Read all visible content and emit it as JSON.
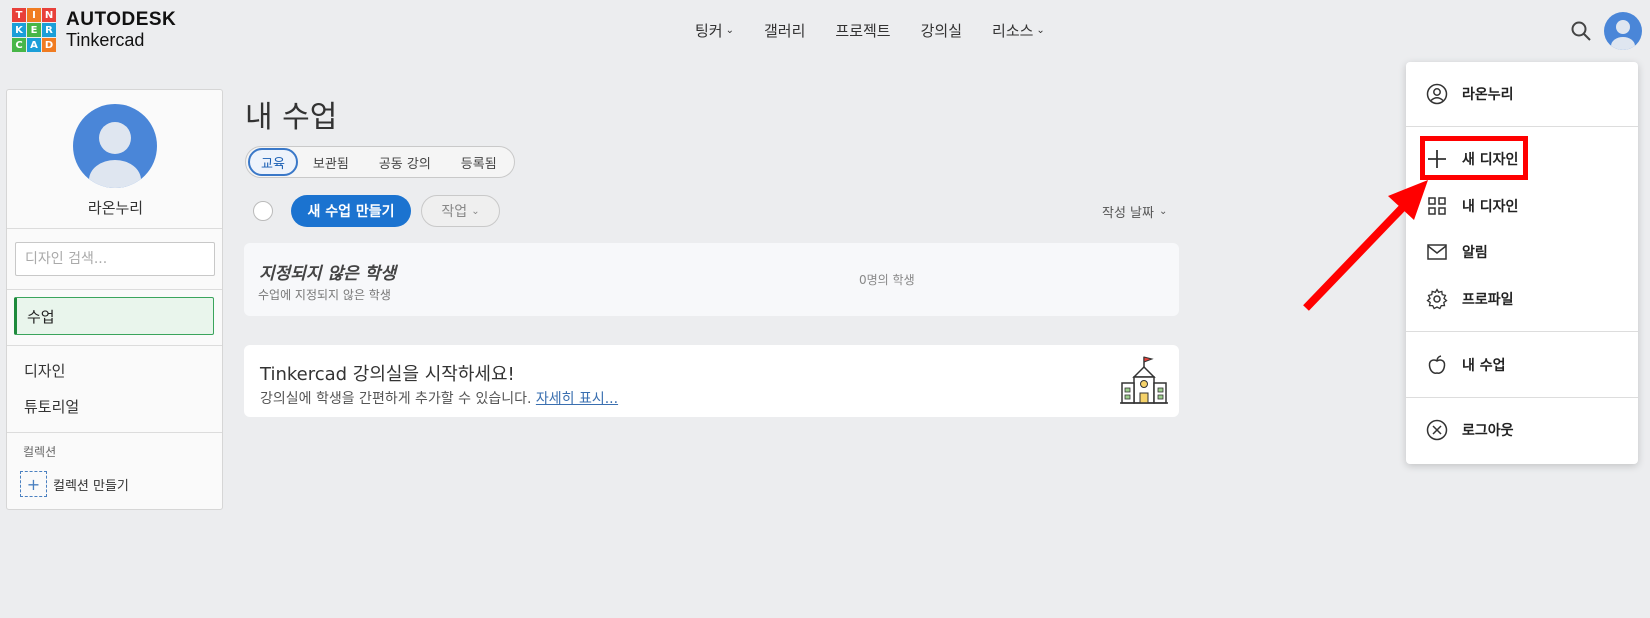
{
  "header": {
    "logo_letters": [
      "T",
      "I",
      "N",
      "K",
      "E",
      "R",
      "C",
      "A",
      "D"
    ],
    "logo_colors": [
      "#e8403a",
      "#f07c22",
      "#e8403a",
      "#1b9fd8",
      "#47b648",
      "#1b9fd8",
      "#47b648",
      "#1b9fd8",
      "#f07c22"
    ],
    "brand_line1": "AUTODESK",
    "brand_line2": "Tinkercad",
    "nav": [
      {
        "label": "팅커",
        "has_dropdown": true
      },
      {
        "label": "갤러리",
        "has_dropdown": false
      },
      {
        "label": "프로젝트",
        "has_dropdown": false
      },
      {
        "label": "강의실",
        "has_dropdown": false
      },
      {
        "label": "리소스",
        "has_dropdown": true
      }
    ],
    "icons": [
      "search-icon",
      "user-avatar"
    ]
  },
  "sidebar": {
    "user_name": "라온누리",
    "search_placeholder": "디자인 검색...",
    "active_item": "수업",
    "items": [
      "디자인",
      "튜토리얼"
    ],
    "section_label": "컬렉션",
    "create_collection": "컬렉션 만들기"
  },
  "main": {
    "title": "내 수업",
    "tabs": [
      "교육",
      "보관됨",
      "공동 강의",
      "등록됨"
    ],
    "active_tab": "교육",
    "new_class_button": "새 수업 만들기",
    "action_button": "작업",
    "sort_label": "작성 날짜",
    "unassigned": {
      "title": "지정되지 않은 학생",
      "subtitle": "수업에 지정되지 않은 학생",
      "count": "0명의 학생"
    },
    "promo": {
      "title": "Tinkercad 강의실을 시작하세요!",
      "text": "강의실에 학생을 간편하게 추가할 수 있습니다.",
      "link": "자세히 표시..."
    }
  },
  "dropdown": {
    "items": [
      {
        "label": "라온누리",
        "icon": "user-circle-icon"
      },
      {
        "label": "새 디자인",
        "icon": "plus-icon"
      },
      {
        "label": "내 디자인",
        "icon": "grid-icon"
      },
      {
        "label": "알림",
        "icon": "mail-icon"
      },
      {
        "label": "프로파일",
        "icon": "gear-icon"
      },
      {
        "label": "내 수업",
        "icon": "apple-icon"
      },
      {
        "label": "로그아웃",
        "icon": "close-circle-icon"
      }
    ]
  },
  "annotation": {
    "color": "#ff0000",
    "highlighted_item": "새 디자인"
  }
}
